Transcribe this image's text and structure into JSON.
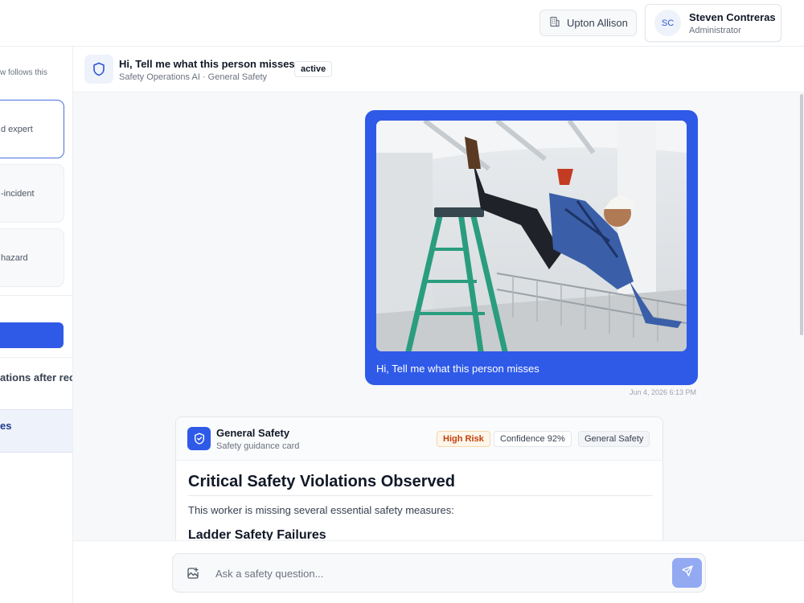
{
  "topbar": {
    "org_label": "Upton Allison",
    "user": {
      "initials": "SC",
      "name": "Steven Contreras",
      "role": "Administrator"
    }
  },
  "sidebar": {
    "intro_text": "w follows this",
    "prompt_cards": [
      {
        "label": "d expert",
        "selected": true
      },
      {
        "label": "-incident",
        "selected": false
      },
      {
        "label": "hazard",
        "selected": false
      }
    ],
    "conversations": [
      {
        "title": "ations after rec",
        "active": false
      },
      {
        "title": "es",
        "active": true
      }
    ]
  },
  "chat_header": {
    "title": "Hi, Tell me what this person misses",
    "subtitle": "Safety Operations AI · General Safety",
    "status_badge": "active"
  },
  "messages": {
    "user": {
      "text": "Hi, Tell me what this person misses",
      "timestamp": "Jun 4, 2026 6:13 PM"
    },
    "assistant_card": {
      "title": "General Safety",
      "subtitle": "Safety guidance card",
      "risk_badge": "High Risk",
      "confidence_badge": "Confidence 92%",
      "category_badge": "General Safety",
      "heading": "Critical Safety Violations Observed",
      "intro": "This worker is missing several essential safety measures:",
      "section_heading": "Ladder Safety Failures"
    }
  },
  "input": {
    "placeholder": "Ask a safety question..."
  },
  "colors": {
    "primary": "#2f5ae8",
    "risk_text": "#c2410c",
    "risk_bg": "#fef6ea",
    "send_disabled": "#93a9f2"
  },
  "icons": {
    "org": "building-icon",
    "header": "shield-icon",
    "card": "shield-check-icon",
    "attach": "image-plus-icon",
    "send": "send-icon"
  }
}
